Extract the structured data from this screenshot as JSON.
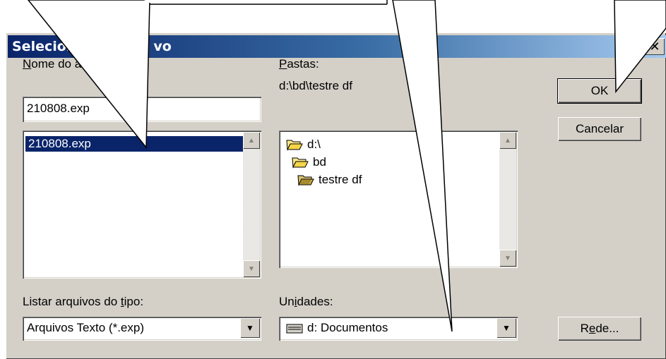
{
  "window": {
    "title": "Selecion",
    "title_tail": "vo",
    "close_glyph": "✕"
  },
  "file_name": {
    "label_key": "N",
    "label_rest": "ome do ar",
    "value": "210808.exp",
    "files": [
      "210808.exp"
    ]
  },
  "folders": {
    "label_key": "P",
    "label_rest": "astas:",
    "current_path": "d:\\bd\\testre df",
    "items": [
      {
        "name": "d:\\",
        "icon": "folder-open-icon"
      },
      {
        "name": "bd",
        "icon": "folder-open-icon"
      },
      {
        "name": "testre df",
        "icon": "folder-open-icon"
      }
    ]
  },
  "file_type": {
    "label_pre": "Listar arquivos do ",
    "label_key": "t",
    "label_post": "ipo:",
    "value": "Arquivos Texto (*.exp)"
  },
  "drives": {
    "label_pre": "Un",
    "label_key": "i",
    "label_post": "dades:",
    "value": "d: Documentos",
    "icon": "drive-icon"
  },
  "buttons": {
    "ok": "OK",
    "cancel": "Cancelar",
    "network_pre": "R",
    "network_key": "e",
    "network_post": "de..."
  },
  "colors": {
    "title_start": "#0a246a",
    "title_end": "#a6caf0",
    "selection": "#0a246a",
    "face": "#d4d0c8"
  }
}
